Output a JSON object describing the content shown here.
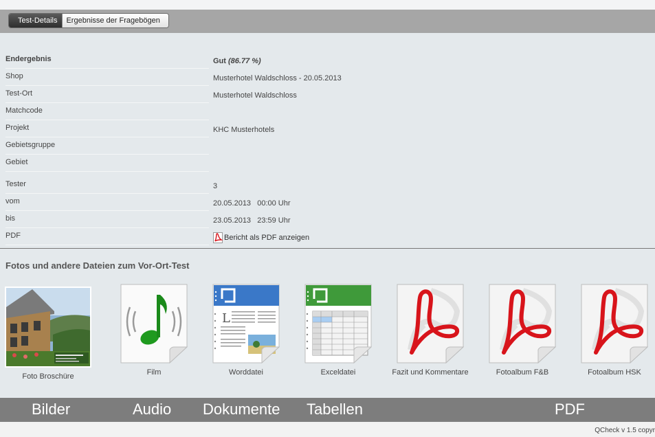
{
  "tabs": [
    {
      "label": "Test-Details",
      "active": true
    },
    {
      "label": "Ergebnisse der Fragebögen",
      "active": false
    }
  ],
  "details": {
    "endergebnis": {
      "label": "Endergebnis",
      "value": "Gut",
      "percent": "(86.77 %)"
    },
    "shop": {
      "label": "Shop",
      "value": "Musterhotel Waldschloss - 20.05.2013"
    },
    "test_ort": {
      "label": "Test-Ort",
      "value": "Musterhotel Waldschloss"
    },
    "matchcode": {
      "label": "Matchcode",
      "value": ""
    },
    "projekt": {
      "label": "Projekt",
      "value": "KHC Musterhotels"
    },
    "gebietsgruppe": {
      "label": "Gebietsgruppe",
      "value": ""
    },
    "gebiet": {
      "label": "Gebiet",
      "value": ""
    },
    "tester": {
      "label": "Tester",
      "value": "3"
    },
    "vom": {
      "label": "vom",
      "value": "20.05.2013   00:00 Uhr"
    },
    "bis": {
      "label": "bis",
      "value": "23.05.2013   23:59 Uhr"
    },
    "pdf": {
      "label": "PDF",
      "link": "Bericht als PDF anzeigen",
      "icon": "pdf-icon"
    }
  },
  "files_section": {
    "title": "Fotos und andere Dateien zum Vor-Ort-Test",
    "files": [
      {
        "caption": "Foto Broschüre",
        "icon": "photo-thumbnail"
      },
      {
        "caption": "Film",
        "icon": "music-note-icon"
      },
      {
        "caption": "Worddatei",
        "icon": "document-icon"
      },
      {
        "caption": "Exceldatei",
        "icon": "spreadsheet-icon"
      },
      {
        "caption": "Fazit und Kommentare",
        "icon": "pdf-icon"
      },
      {
        "caption": "Fotoalbum F&B",
        "icon": "pdf-icon"
      },
      {
        "caption": "Fotoalbum HSK",
        "icon": "pdf-icon"
      }
    ]
  },
  "categories": {
    "bilder": "Bilder",
    "audio": "Audio",
    "dokumente": "Dokumente",
    "tabellen": "Tabellen",
    "pdf": "PDF"
  },
  "footer": {
    "version": "QCheck v 1.5 copyr"
  },
  "colors": {
    "accent_red": "#d8141b",
    "word_blue": "#3a78c8",
    "excel_green": "#3f9a3a",
    "toolbar_gray": "#a6a6a6",
    "category_bar": "#7d7d7d"
  }
}
